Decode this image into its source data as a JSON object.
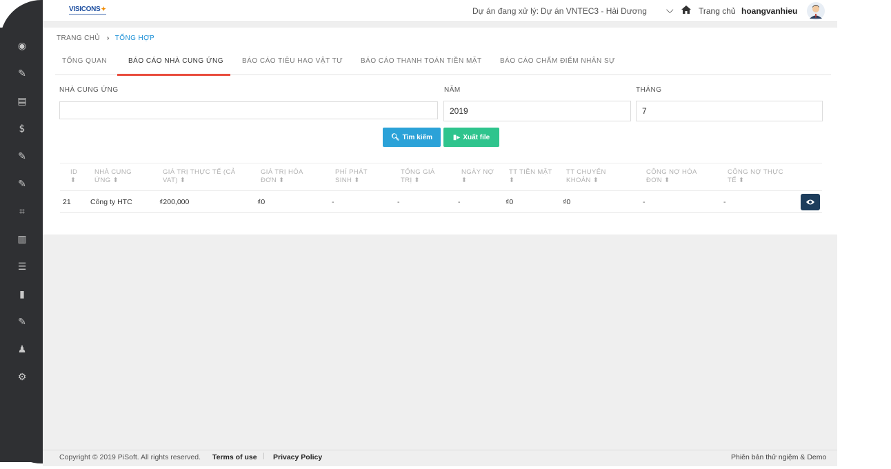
{
  "header": {
    "logo_text": "VISICONS",
    "project_label": "Dự án đang xử lý:",
    "project_value": "Dự án VNTEC3 - Hải Dương",
    "home_label": "Trang chủ",
    "username": "hoangvanhieu"
  },
  "sidebar": {
    "items": [
      {
        "icon": "eye-icon",
        "glyph": "◉"
      },
      {
        "icon": "edit-document-icon",
        "glyph": "✎"
      },
      {
        "icon": "id-card-icon",
        "glyph": "▤"
      },
      {
        "icon": "dollar-icon",
        "glyph": "$"
      },
      {
        "icon": "edit-document-icon",
        "glyph": "✎"
      },
      {
        "icon": "edit-document-icon",
        "glyph": "✎"
      },
      {
        "icon": "crop-icon",
        "glyph": "⌗"
      },
      {
        "icon": "book-icon",
        "glyph": "▥"
      },
      {
        "icon": "checklist-icon",
        "glyph": "☰"
      },
      {
        "icon": "barcode-icon",
        "glyph": "▮"
      },
      {
        "icon": "edit-document-icon",
        "glyph": "✎"
      },
      {
        "icon": "users-icon",
        "glyph": "♟"
      },
      {
        "icon": "user-settings-icon",
        "glyph": "⚙"
      }
    ]
  },
  "breadcrumb": {
    "home": "TRANG CHỦ",
    "separator": "›",
    "current": "TỔNG HỢP"
  },
  "tabs": [
    {
      "label": "TỔNG QUAN",
      "active": false
    },
    {
      "label": "BÁO CÁO NHÀ CUNG ỨNG",
      "active": true
    },
    {
      "label": "BÁO CÁO TIÊU HAO VẬT TƯ",
      "active": false
    },
    {
      "label": "BÁO CÁO THANH TOÁN TIỀN MẶT",
      "active": false
    },
    {
      "label": "BÁO CÁO CHẤM ĐIỂM NHÂN SỰ",
      "active": false
    }
  ],
  "filters": {
    "supplier_label": "NHÀ CUNG ỨNG",
    "supplier_value": "",
    "year_label": "NĂM",
    "year_value": "2019",
    "month_label": "THÁNG",
    "month_value": "7"
  },
  "actions": {
    "search_label": "Tìm kiếm",
    "export_label": "Xuất file"
  },
  "table": {
    "columns": [
      {
        "line1": "ID",
        "line2": "⬍"
      },
      {
        "line1": "NHÀ CUNG",
        "line2": "ỨNG ⬍"
      },
      {
        "line1": "GIÁ TRỊ THỰC TẾ (CẢ",
        "line2": "VAT) ⬍"
      },
      {
        "line1": "GIÁ TRỊ HÓA",
        "line2": "ĐƠN ⬍"
      },
      {
        "line1": "PHÍ PHÁT",
        "line2": "SINH ⬍"
      },
      {
        "line1": "TỔNG GIÁ",
        "line2": "TRỊ ⬍"
      },
      {
        "line1": "NGÀY NỢ",
        "line2": "⬍"
      },
      {
        "line1": "TT TIỀN MẶT",
        "line2": "⬍"
      },
      {
        "line1": "TT CHUYỂN",
        "line2": "KHOẢN ⬍"
      },
      {
        "line1": "CÔNG NỢ HÓA",
        "line2": "ĐƠN ⬍"
      },
      {
        "line1": "CÔNG NỢ THỰC",
        "line2": "TẾ ⬍"
      }
    ],
    "rows": [
      {
        "id": "21",
        "supplier": "Công ty HTC",
        "actual_value": "₫200,000",
        "invoice_value": "₫0",
        "extra_fee": "-",
        "total_value": "-",
        "debt_date": "-",
        "cash_paid": "₫0",
        "transfer_paid": "₫0",
        "invoice_debt": "-",
        "actual_debt": "-"
      }
    ]
  },
  "footer": {
    "copyright": "Copyright © 2019 PiSoft. All rights reserved.",
    "terms": "Terms of use",
    "separator": "|",
    "privacy": "Privacy Policy",
    "version": "Phiên bản thử ngiệm & Demo"
  },
  "colors": {
    "sidebar_bg": "#2f3033",
    "accent_tab": "#e84c3d",
    "search_button": "#2ba2d8",
    "export_button": "#2fc48d",
    "view_button": "#1d3d5c",
    "breadcrumb_current": "#1a8fd6"
  }
}
